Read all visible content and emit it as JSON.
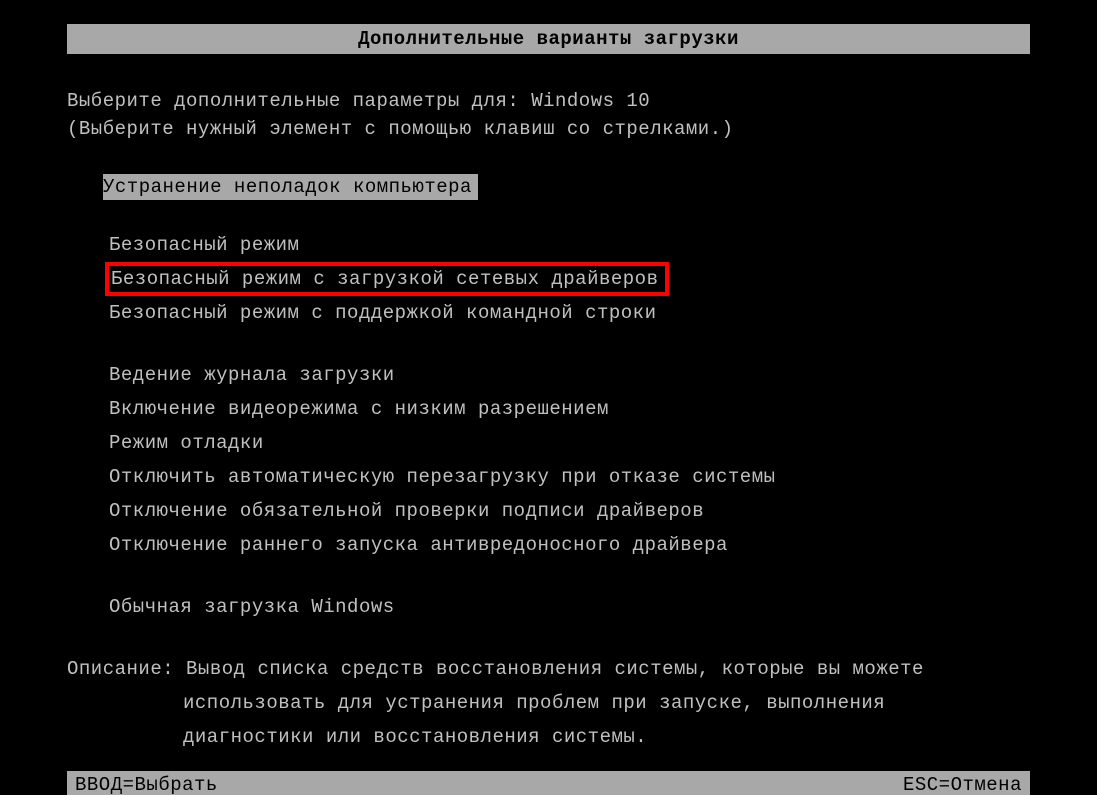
{
  "title": "Дополнительные варианты загрузки",
  "prompt": {
    "label": "Выберите дополнительные параметры для: ",
    "os": "Windows 10"
  },
  "hint": "(Выберите нужный элемент с помощью клавиш со стрелками.)",
  "selected": "Устранение неполадок компьютера",
  "groups": [
    {
      "items": [
        "Безопасный режим",
        "Безопасный режим с загрузкой сетевых драйверов",
        "Безопасный режим с поддержкой командной строки"
      ],
      "highlightIndex": 1
    },
    {
      "items": [
        "Ведение журнала загрузки",
        "Включение видеорежима с низким разрешением",
        "Режим отладки",
        "Отключить автоматическую перезагрузку при отказе системы",
        "Отключение обязательной проверки подписи драйверов",
        "Отключение раннего запуска антивредоносного драйвера"
      ]
    },
    {
      "items": [
        "Обычная загрузка Windows"
      ]
    }
  ],
  "description": {
    "label": "Описание: ",
    "lines": [
      "Вывод списка средств восстановления системы, которые вы можете",
      "использовать для устранения проблем при запуске, выполнения",
      "диагностики или восстановления системы."
    ]
  },
  "footer": {
    "enter": "ВВОД=Выбрать",
    "esc": "ESC=Отмена"
  }
}
